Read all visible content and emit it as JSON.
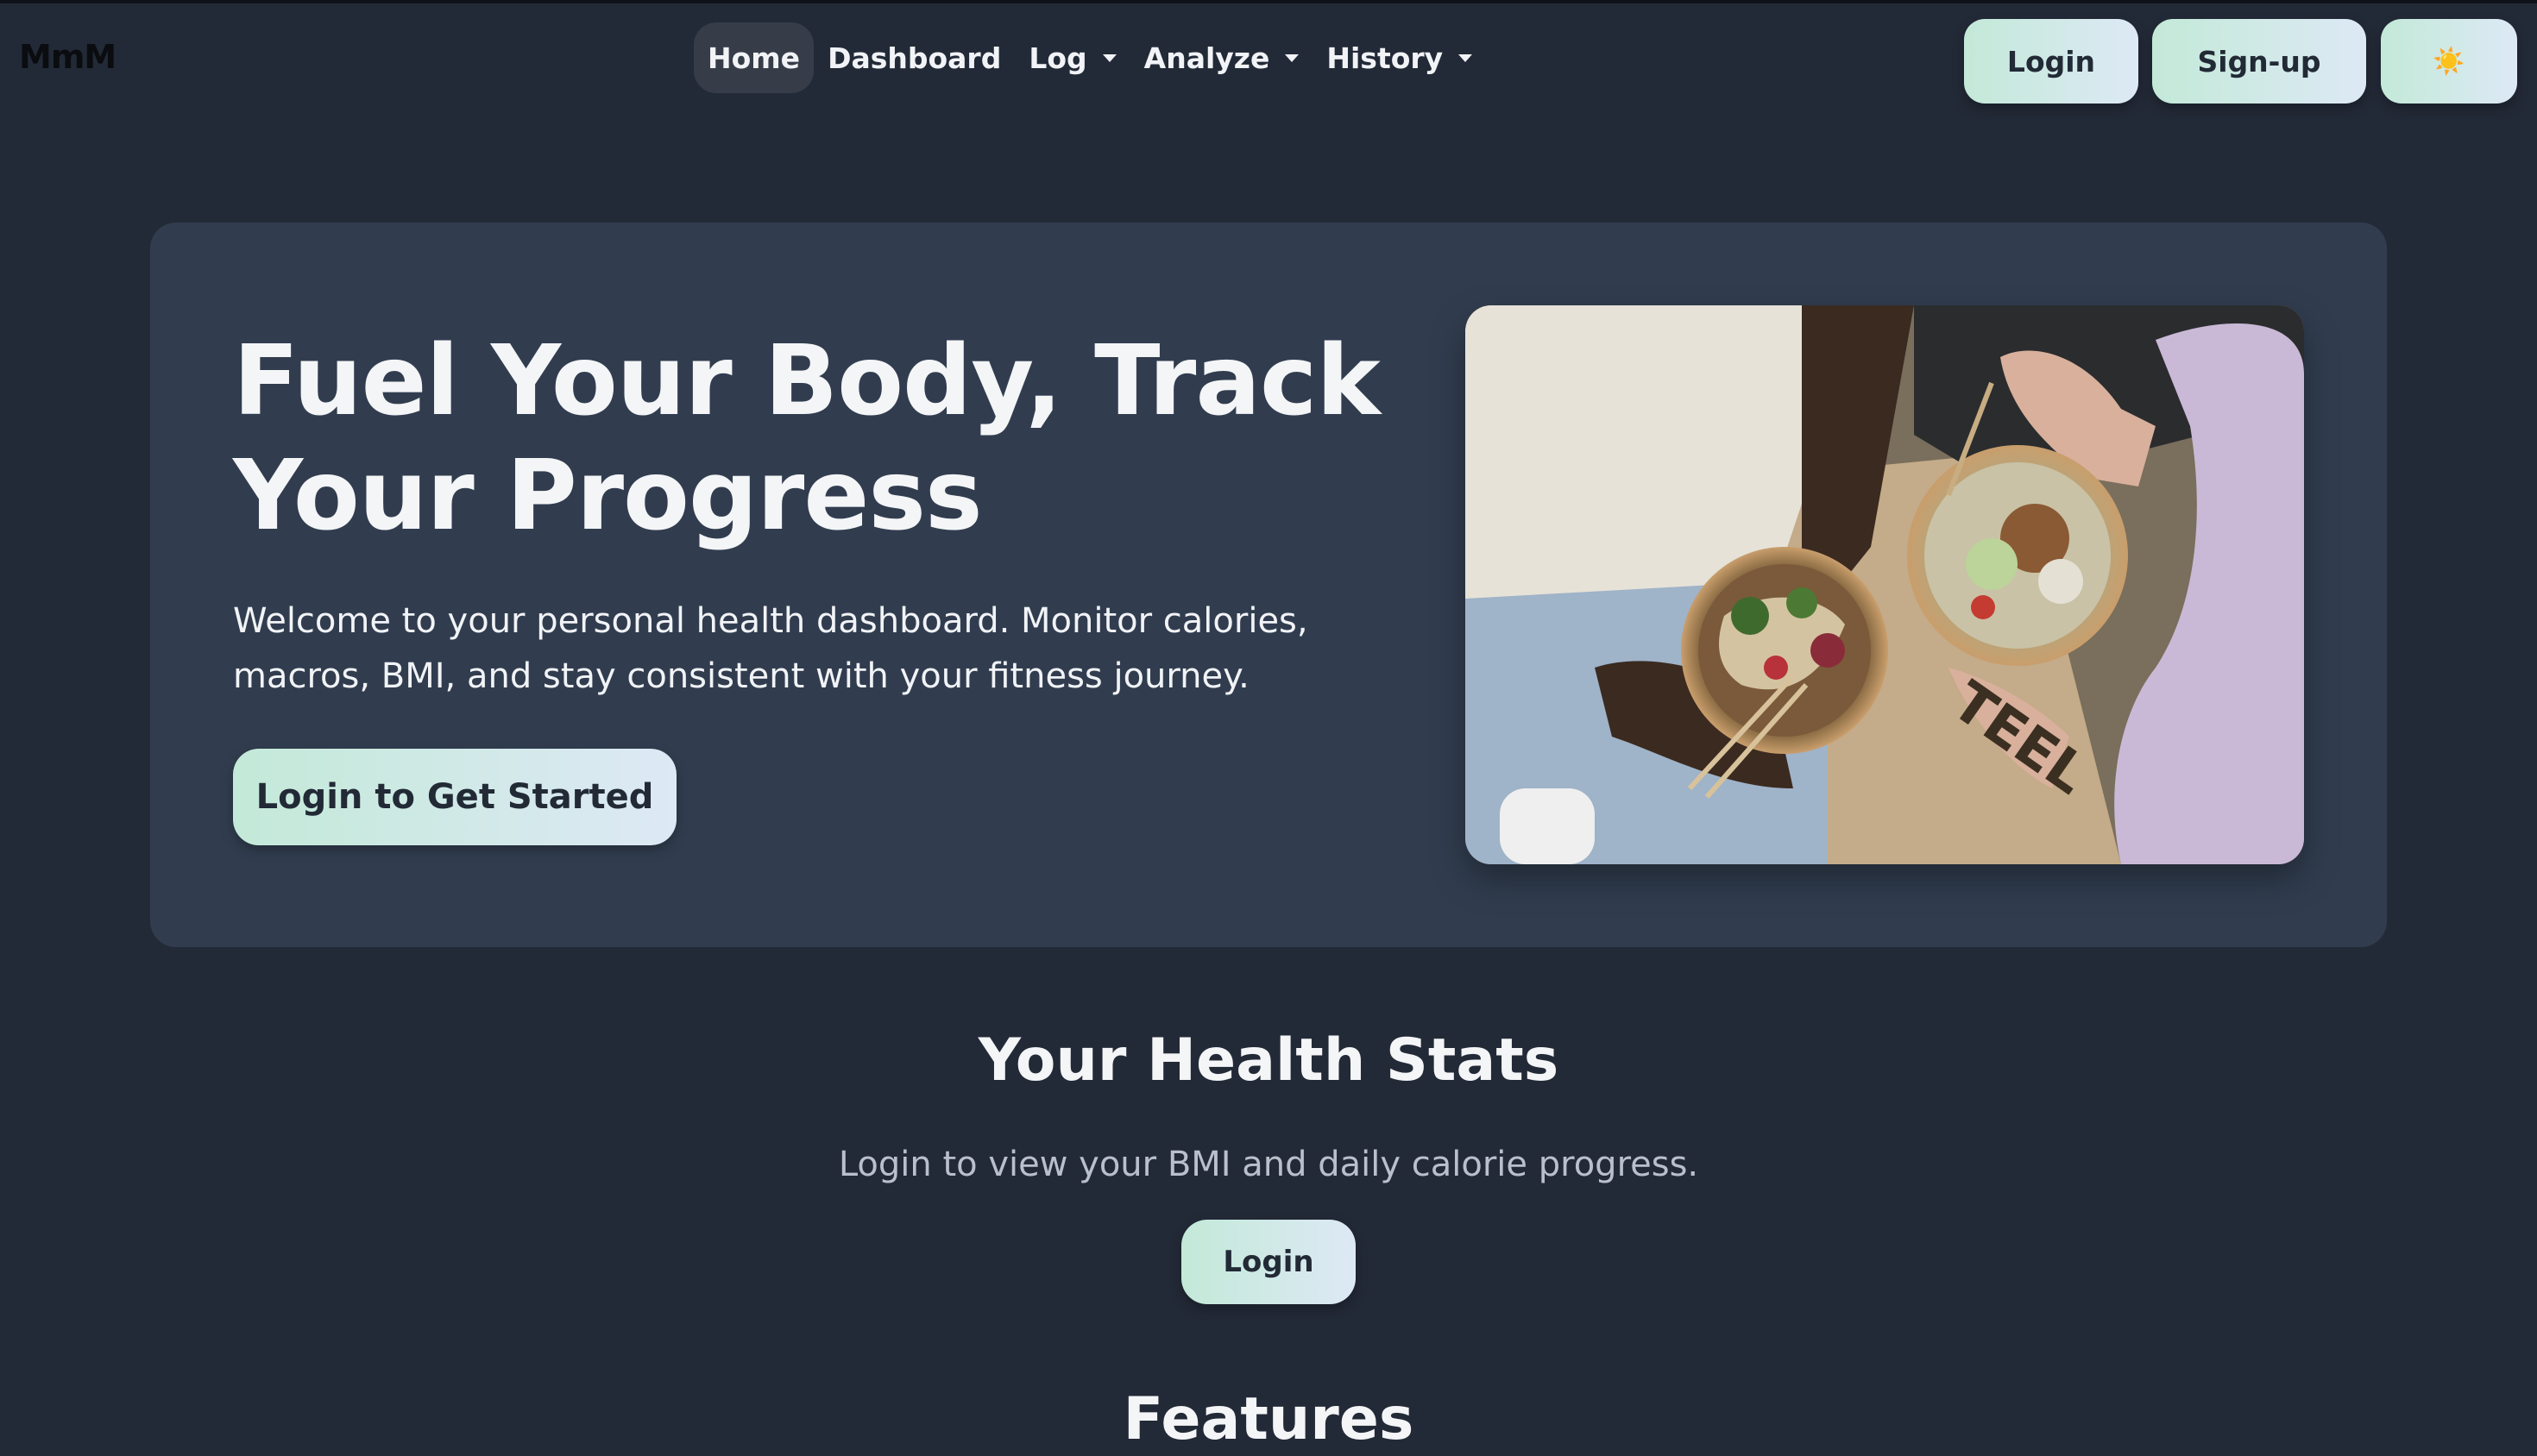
{
  "brand": "MmM",
  "nav": {
    "home": "Home",
    "dashboard": "Dashboard",
    "log": "Log",
    "analyze": "Analyze",
    "history": "History"
  },
  "auth": {
    "login": "Login",
    "signup": "Sign-up",
    "theme_toggle": "☀️"
  },
  "hero": {
    "title": "Fuel Your Body, Track Your Progress",
    "subtitle": "Welcome to your personal health dashboard. Monitor calories, macros, BMI, and stay consistent with your fitness journey.",
    "cta": "Login to Get Started"
  },
  "stats": {
    "title": "Your Health Stats",
    "subtitle": "Login to view your BMI and daily calorie progress.",
    "button": "Login"
  },
  "features": {
    "title": "Features"
  },
  "colors": {
    "background": "#232a37",
    "card": "#313d4f",
    "button_gradient_start": "#c3e9d8",
    "button_gradient_end": "#dde9f5",
    "button_text": "#222a36"
  }
}
